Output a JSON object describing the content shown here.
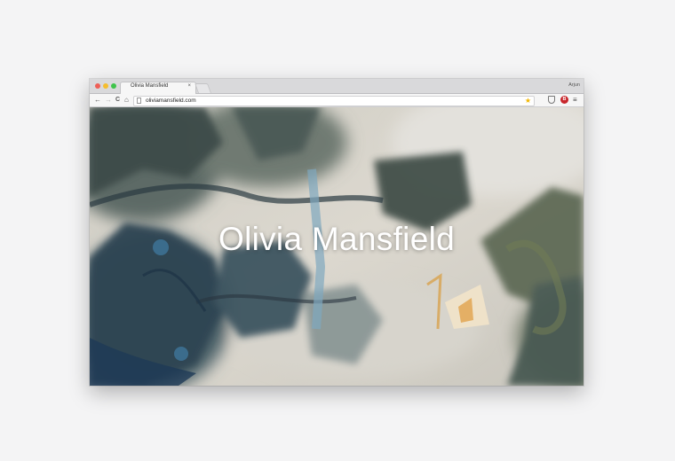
{
  "browser": {
    "tab_title": "Olivia Mansfield",
    "tab_close": "×",
    "profile_name": "Arjun",
    "url": "oliviamansfield.com",
    "back_icon": "←",
    "forward_icon": "→",
    "reload_icon": "C",
    "home_icon": "⌂",
    "star_icon": "★",
    "adblock_label": "B",
    "menu_icon": "≡"
  },
  "hero": {
    "title": "Olivia Mansfield"
  },
  "colors": {
    "page_background": "#f4f4f5",
    "titlebar": "#d9d9db",
    "star": "#f2b600",
    "adblock": "#c8262b"
  }
}
